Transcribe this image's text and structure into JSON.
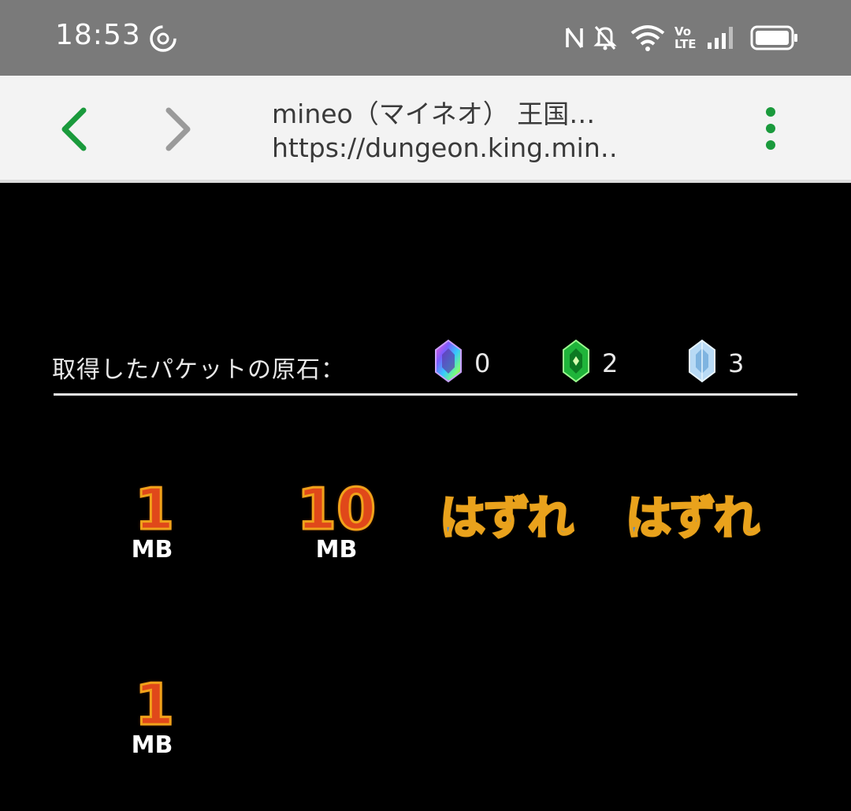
{
  "status_bar": {
    "time": "18:53",
    "icons": [
      "sync-icon",
      "nfc-icon",
      "mute-icon",
      "wifi-icon",
      "volte-icon",
      "signal-icon",
      "battery-icon"
    ],
    "volte_label_top": "Vo",
    "volte_label_bottom": "LTE"
  },
  "browser": {
    "title": "mineo（マイネオ） 王国…",
    "url": "https://dungeon.king.min…",
    "accent_color": "#1a9a3c"
  },
  "game": {
    "stones_label": "取得したパケットの原石：",
    "stones": [
      {
        "icon": "rainbow-gem-icon",
        "count": "0"
      },
      {
        "icon": "green-gem-icon",
        "count": "2"
      },
      {
        "icon": "ice-gem-icon",
        "count": "3"
      }
    ],
    "results": [
      {
        "value": "1",
        "unit": "MB"
      },
      {
        "value": "10",
        "unit": "MB"
      },
      {
        "miss": "はずれ"
      },
      {
        "miss": "はずれ"
      },
      {
        "value": "1",
        "unit": "MB"
      }
    ]
  }
}
